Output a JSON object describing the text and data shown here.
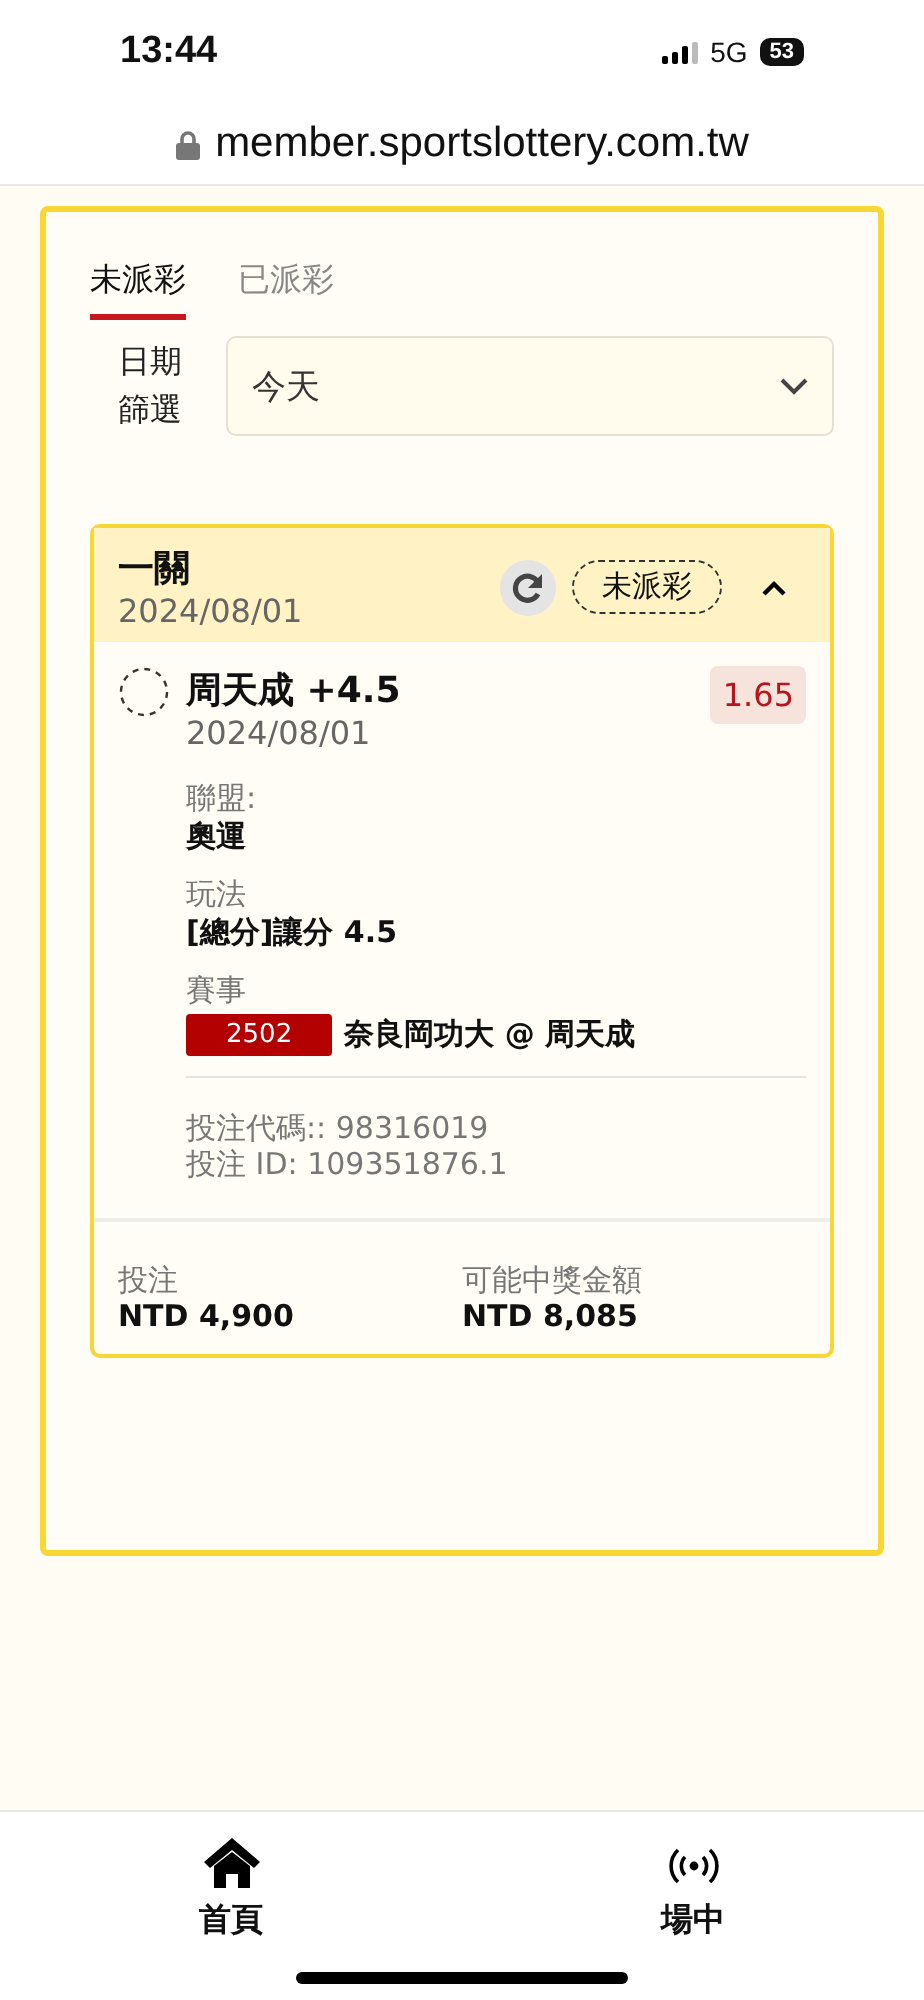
{
  "status_bar": {
    "time": "13:44",
    "network": "5G",
    "battery": "53"
  },
  "address_bar": {
    "url": "member.sportslottery.com.tw"
  },
  "tabs": [
    {
      "label": "未派彩",
      "selected": true
    },
    {
      "label": "已派彩",
      "selected": false
    }
  ],
  "date_filter": {
    "label": "日期篩選",
    "value": "今天"
  },
  "bet": {
    "type": "一關",
    "date": "2024/08/01",
    "status": "未派彩",
    "expanded": true,
    "selection": {
      "name": "周天成 +4.5",
      "date": "2024/08/01",
      "odds": "1.65"
    },
    "details": [
      {
        "label": "聯盟:",
        "value": "奧運"
      },
      {
        "label": "玩法",
        "value": "[總分]讓分 4.5"
      }
    ],
    "event": {
      "label": "賽事",
      "code": "2502",
      "match": "奈良岡功大 @ 周天成"
    },
    "codes": [
      "投注代碼:: 98316019",
      "投注 ID: 109351876.1"
    ],
    "stake": {
      "label": "投注",
      "value": "NTD 4,900"
    },
    "payout": {
      "label": "可能中獎金額",
      "value": "NTD 8,085"
    }
  },
  "bottom_nav": [
    {
      "kind": "home",
      "label": "首頁"
    },
    {
      "kind": "live",
      "label": "場中"
    }
  ]
}
